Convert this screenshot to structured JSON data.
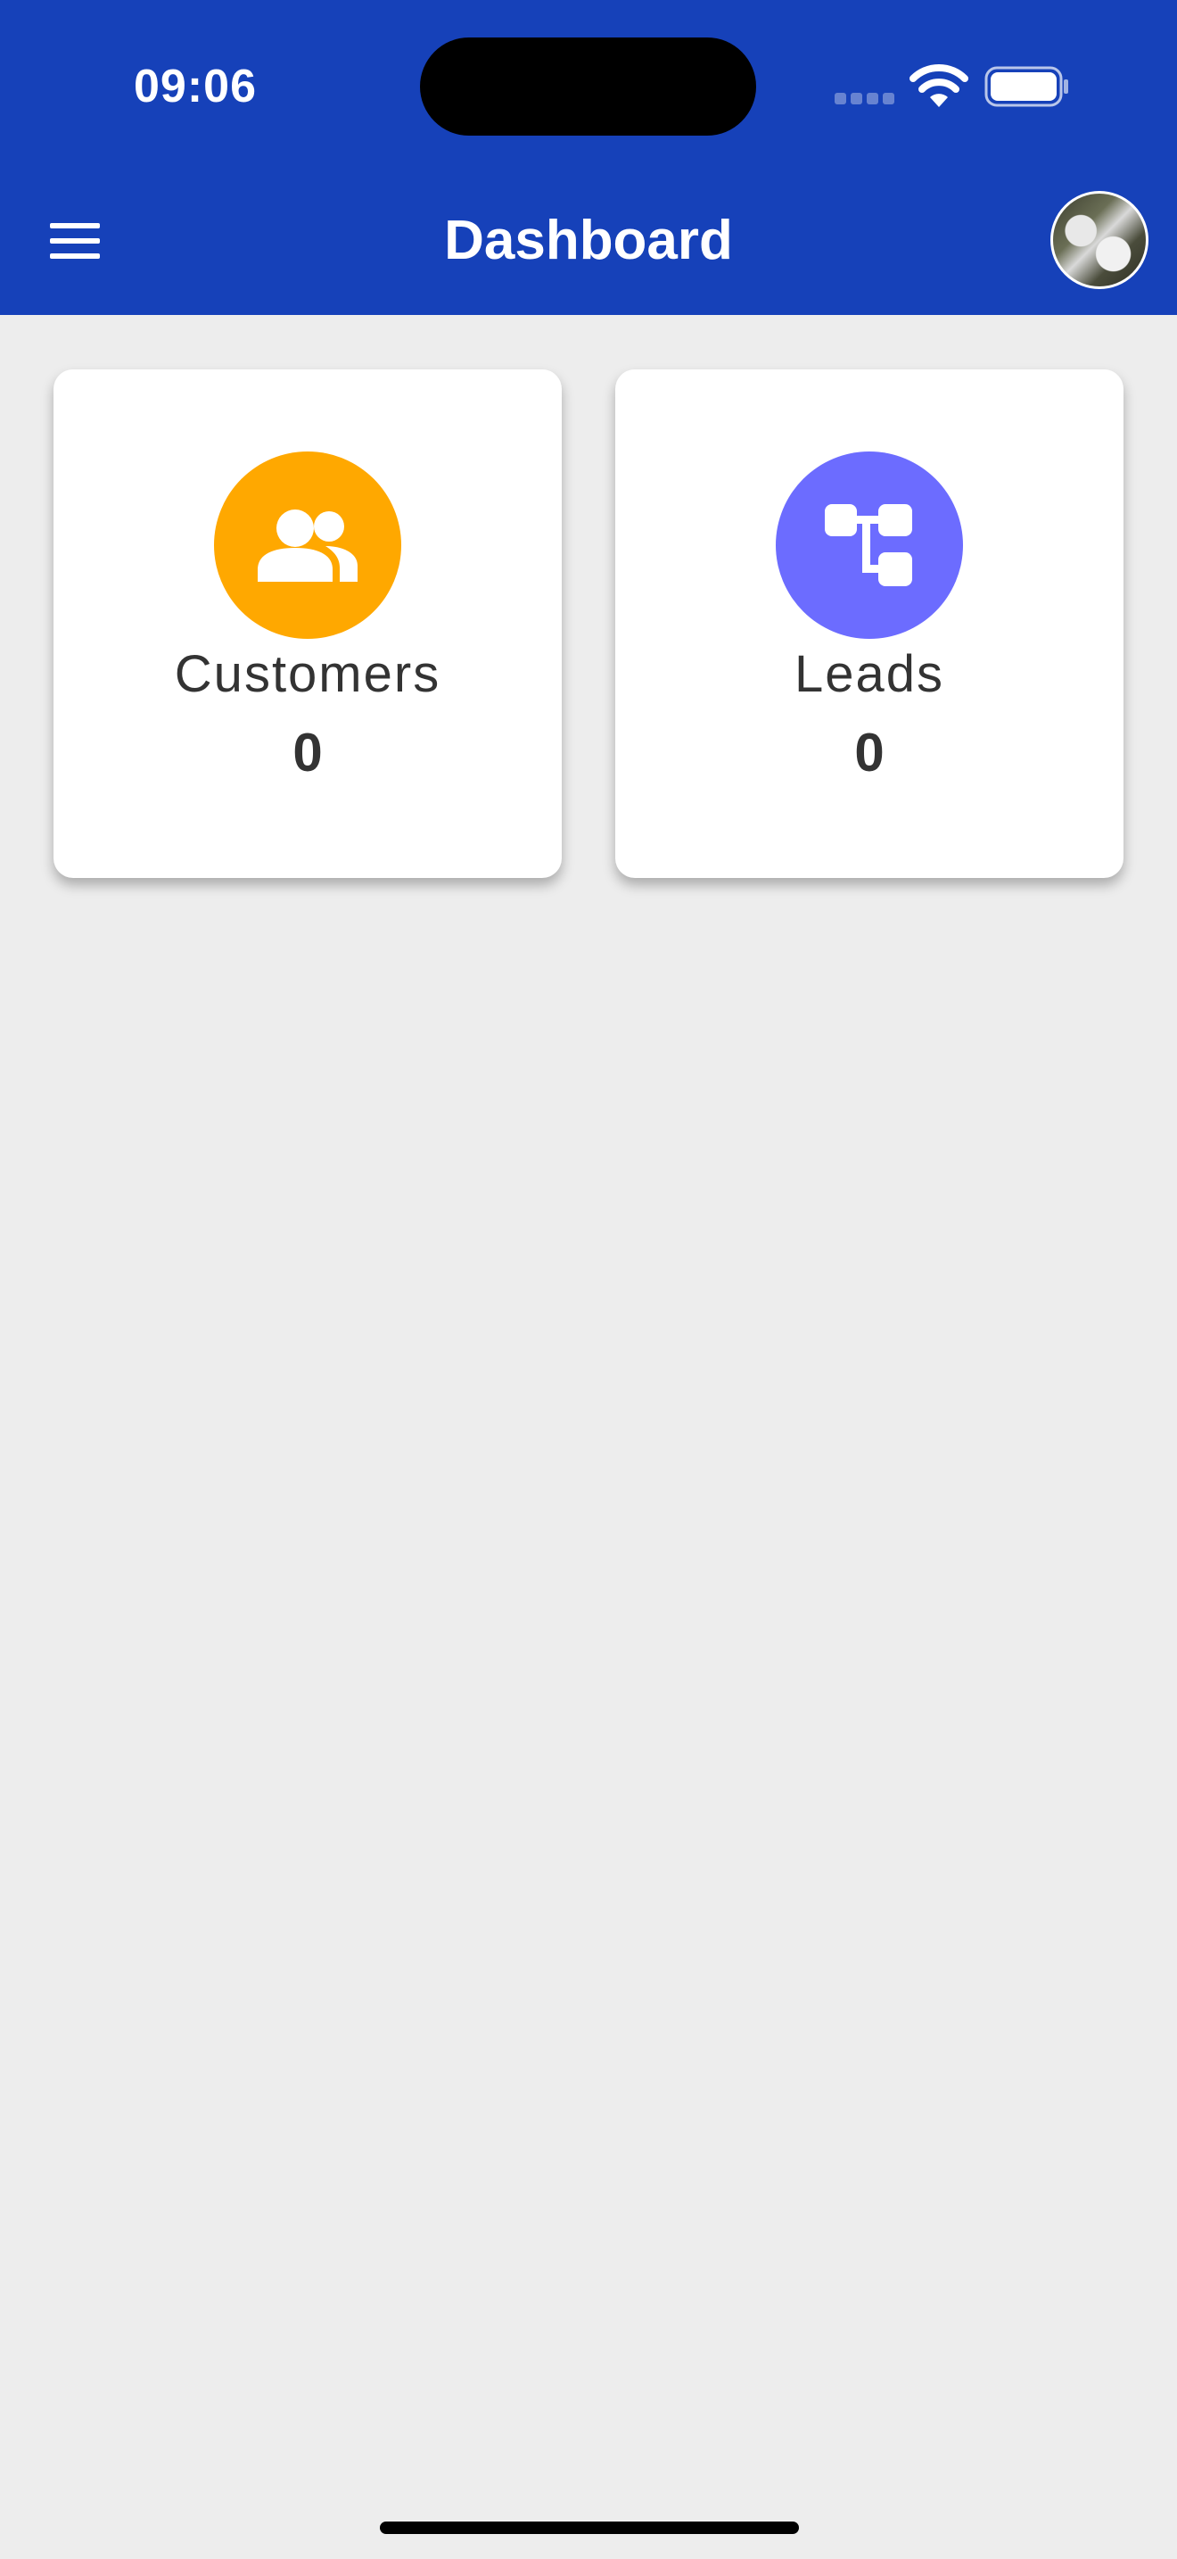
{
  "status_bar": {
    "time": "09:06"
  },
  "header": {
    "title": "Dashboard",
    "background_color": "#1641b9"
  },
  "icons": {
    "menu": "hamburger-menu-icon",
    "avatar": "user-avatar",
    "customers": "people-icon",
    "leads": "flow-diagram-icon"
  },
  "cards": [
    {
      "label": "Customers",
      "count": "0",
      "color": "#ffa800"
    },
    {
      "label": "Leads",
      "count": "0",
      "color": "#6c6cff"
    }
  ]
}
